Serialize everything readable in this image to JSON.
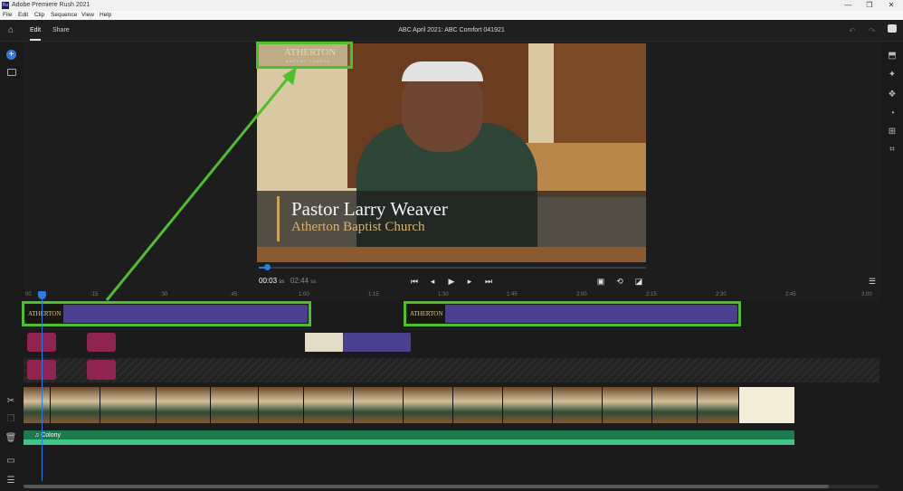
{
  "window": {
    "app_icon": "Ru",
    "title": "Adobe Premiere Rush 2021",
    "controls": [
      "—",
      "❐",
      "✕"
    ]
  },
  "menu": [
    "File",
    "Edit",
    "Clip",
    "Sequence",
    "View",
    "Help"
  ],
  "header": {
    "tabs": [
      "Edit",
      "Share"
    ],
    "active_tab": "Edit",
    "project_title": "ABC April 2021: ABC Comfort 041921"
  },
  "preview": {
    "logo_text": "ATHERTON",
    "logo_sub": "BAPTIST CHURCH",
    "lower_third_name": "Pastor Larry Weaver",
    "lower_third_org": "Atherton Baptist Church"
  },
  "playback": {
    "current_time": "00:03",
    "current_unit": "ss",
    "duration": "02:44",
    "duration_unit": "ss",
    "progress": 0.02
  },
  "timeline": {
    "ruler_labels": [
      "00",
      ":15",
      ":30",
      ":45",
      "1:00",
      "1:15",
      "1:30",
      "1:45",
      "2:00",
      "2:15",
      "2:30",
      "2:45",
      "3:00"
    ],
    "title_clip_1_label": "ATHERTON",
    "title_clip_2_label": "ATHERTON",
    "audio_track_name": "Colony"
  },
  "colors": {
    "highlight": "#4fbf2a",
    "playhead": "#2d7be0",
    "title_clip": "#4b3f8f",
    "graphic_clip": "#8f2450",
    "audio": "#1e7a4d"
  },
  "icons": {
    "left_rail": [
      "home-icon",
      "add-media-icon",
      "project-panel-icon",
      "scissors-icon",
      "duplicate-icon",
      "trash-icon",
      "track-toggle-icon",
      "timeline-list-icon"
    ],
    "right_rail": [
      "chat-icon",
      "transitions-icon",
      "color-icon",
      "effects-icon",
      "speed-icon",
      "transform-icon",
      "crop-icon"
    ]
  }
}
